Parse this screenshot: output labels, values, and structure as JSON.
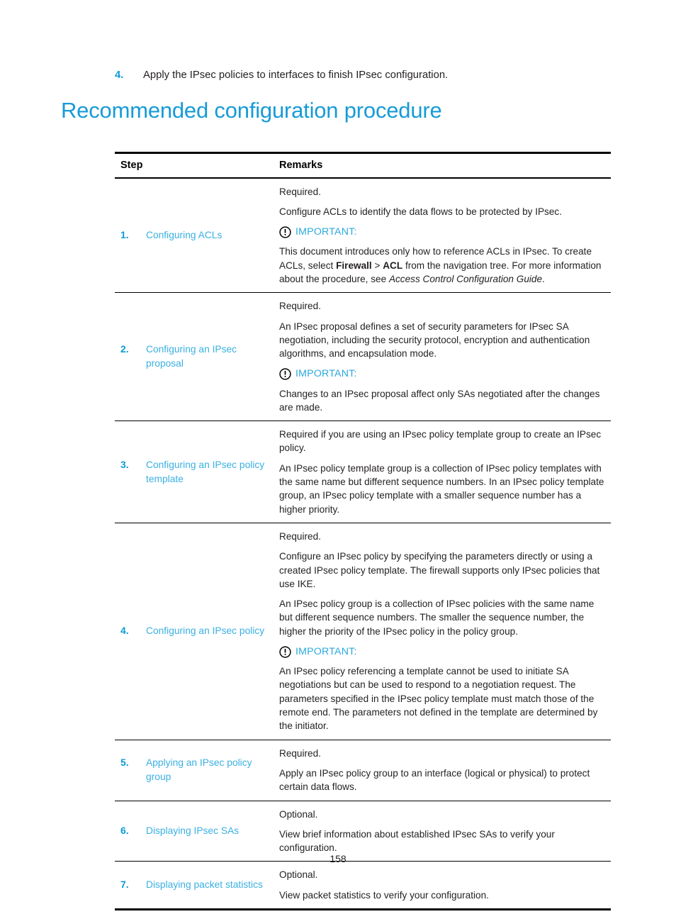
{
  "top_step": {
    "number": "4.",
    "text": "Apply the IPsec policies to interfaces to finish IPsec configuration."
  },
  "heading": "Recommended configuration procedure",
  "table": {
    "headers": {
      "step": "Step",
      "remarks": "Remarks"
    },
    "important_label": "IMPORTANT:",
    "rows": [
      {
        "number": "1.",
        "link": "Configuring ACLs",
        "blocks": [
          {
            "kind": "p",
            "text": "Required."
          },
          {
            "kind": "p",
            "text": "Configure ACLs to identify the data flows to be protected by IPsec."
          },
          {
            "kind": "important"
          },
          {
            "kind": "rich",
            "parts": [
              {
                "t": "This document introduces only how to reference ACLs in IPsec. To create ACLs, select ",
                "style": "normal"
              },
              {
                "t": "Firewall",
                "style": "bold"
              },
              {
                "t": " > ",
                "style": "normal"
              },
              {
                "t": "ACL",
                "style": "bold"
              },
              {
                "t": " from the navigation tree. For more information about the procedure, see ",
                "style": "normal"
              },
              {
                "t": "Access Control Configuration Guide",
                "style": "italic"
              },
              {
                "t": ".",
                "style": "normal"
              }
            ]
          }
        ]
      },
      {
        "number": "2.",
        "link": "Configuring an IPsec proposal",
        "blocks": [
          {
            "kind": "p",
            "text": "Required."
          },
          {
            "kind": "p",
            "text": "An IPsec proposal defines a set of security parameters for IPsec SA negotiation, including the security protocol, encryption and authentication algorithms, and encapsulation mode."
          },
          {
            "kind": "important"
          },
          {
            "kind": "p",
            "text": "Changes to an IPsec proposal affect only SAs negotiated after the changes are made."
          }
        ]
      },
      {
        "number": "3.",
        "link": "Configuring an IPsec policy template",
        "blocks": [
          {
            "kind": "p",
            "text": "Required if you are using an IPsec policy template group to create an IPsec policy."
          },
          {
            "kind": "p",
            "text": "An IPsec policy template group is a collection of IPsec policy templates with the same name but different sequence numbers. In an IPsec policy template group, an IPsec policy template with a smaller sequence number has a higher priority."
          }
        ]
      },
      {
        "number": "4.",
        "link": "Configuring an IPsec policy",
        "blocks": [
          {
            "kind": "p",
            "text": "Required."
          },
          {
            "kind": "p",
            "text": "Configure an IPsec policy by specifying the parameters directly or using a created IPsec policy template. The firewall supports only IPsec policies that use IKE."
          },
          {
            "kind": "p",
            "text": "An IPsec policy group is a collection of IPsec policies with the same name but different sequence numbers. The smaller the sequence number, the higher the priority of the IPsec policy in the policy group."
          },
          {
            "kind": "important"
          },
          {
            "kind": "p",
            "text": "An IPsec policy referencing a template cannot be used to initiate SA negotiations but can be used to respond to a negotiation request. The parameters specified in the IPsec policy template must match those of the remote end. The parameters not defined in the template are determined by the initiator."
          }
        ]
      },
      {
        "number": "5.",
        "link": "Applying an IPsec policy group",
        "blocks": [
          {
            "kind": "p",
            "text": "Required."
          },
          {
            "kind": "p",
            "text": "Apply an IPsec policy group to an interface (logical or physical) to protect certain data flows."
          }
        ]
      },
      {
        "number": "6.",
        "link": "Displaying IPsec SAs",
        "blocks": [
          {
            "kind": "p",
            "text": "Optional."
          },
          {
            "kind": "p",
            "text": "View brief information about established IPsec SAs to verify your configuration."
          }
        ]
      },
      {
        "number": "7.",
        "link": "Displaying packet statistics",
        "blocks": [
          {
            "kind": "p",
            "text": "Optional."
          },
          {
            "kind": "p",
            "text": "View packet statistics to verify your configuration."
          }
        ]
      }
    ]
  },
  "page_number": "158",
  "colors": {
    "heading_blue": "#179bd7",
    "link_blue": "#3ab0e2",
    "number_blue": "#0c9ad6",
    "important_blue": "#2aa8de",
    "body_text": "#231f20",
    "rule": "#000000"
  }
}
